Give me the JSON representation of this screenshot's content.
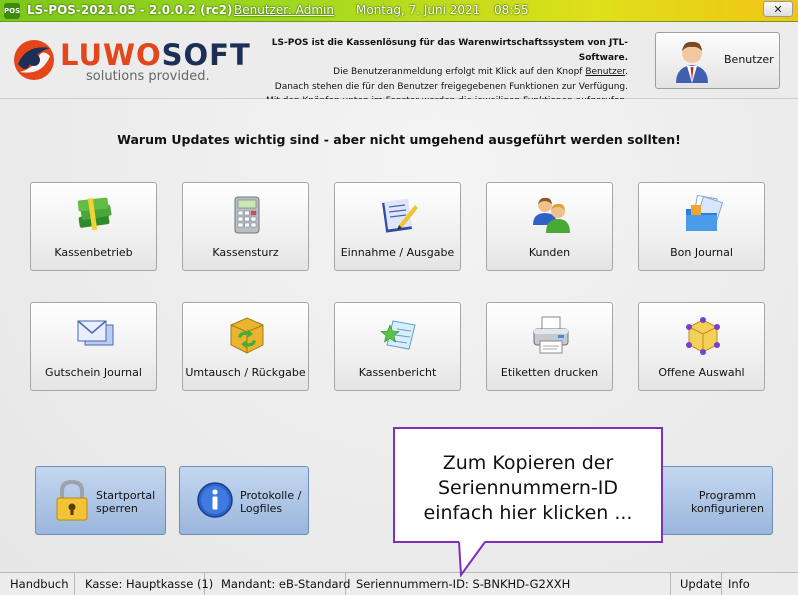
{
  "titlebar": {
    "app_icon": "POS",
    "title": "LS-POS-2021.05 - 2.0.0.2 (rc2)",
    "user": "Benutzer: Admin",
    "date": "Montag, 7. Juni 2021",
    "time": "08:55",
    "close_label": "✕"
  },
  "header": {
    "logo_part1": "LUWO",
    "logo_part2": "SOFT",
    "logo_tagline": "solutions provided.",
    "info_line1": "LS-POS ist die Kassenlösung für das Warenwirtschaftssystem von JTL-Software.",
    "info_line2_pre": "Die Benutzeranmeldung erfolgt mit Klick auf den Knopf ",
    "info_line2_link": "Benutzer",
    "info_line2_post": ".",
    "info_line3": "Danach stehen die für den Benutzer freigegebenen Funktionen zur Verfügung.",
    "info_line4": "Mit den Knöpfen unten im Fenster werden die jeweiligen Funktionen aufgerufen.",
    "user_button_label": "Benutzer"
  },
  "content": {
    "headline": "Warum Updates wichtig sind - aber nicht umgehend ausgeführt werden sollten!",
    "tiles_row1": [
      "Kassenbetrieb",
      "Kassensturz",
      "Einnahme / Ausgabe",
      "Kunden",
      "Bon Journal"
    ],
    "tiles_row2": [
      "Gutschein Journal",
      "Umtausch / Rückgabe",
      "Kassenbericht",
      "Etiketten drucken",
      "Offene Auswahl"
    ],
    "bottom_buttons": {
      "lock_line1": "Startportal",
      "lock_line2": "sperren",
      "logs_line1": "Protokolle /",
      "logs_line2": "Logfiles",
      "config_line1": "Programm",
      "config_line2": "konfigurieren"
    },
    "callout_line1": "Zum Kopieren der",
    "callout_line2": "Seriennummern-ID",
    "callout_line3": "einfach hier klicken ..."
  },
  "statusbar": {
    "handbook": "Handbuch",
    "register": "Kasse: Hauptkasse (1)",
    "client": "Mandant: eB-Standard",
    "serial": "Seriennummern-ID:  S-BNKHD-G2XXH",
    "update": "Update",
    "info": "Info"
  },
  "colors": {
    "titlebar_accent": "#9fd81e",
    "callout_border": "#7d2fbe",
    "bottom_button": "#a9c2e4"
  },
  "icons": {
    "tiles_row1": [
      "money-stack-icon",
      "calculator-icon",
      "notepad-pencil-icon",
      "customers-icon",
      "folder-journal-icon"
    ],
    "tiles_row2": [
      "envelope-icon",
      "exchange-box-icon",
      "report-star-icon",
      "printer-icon",
      "cube-selection-icon"
    ],
    "user_button": "user-avatar-icon",
    "lock_button": "padlock-icon",
    "logs_button": "info-icon"
  }
}
